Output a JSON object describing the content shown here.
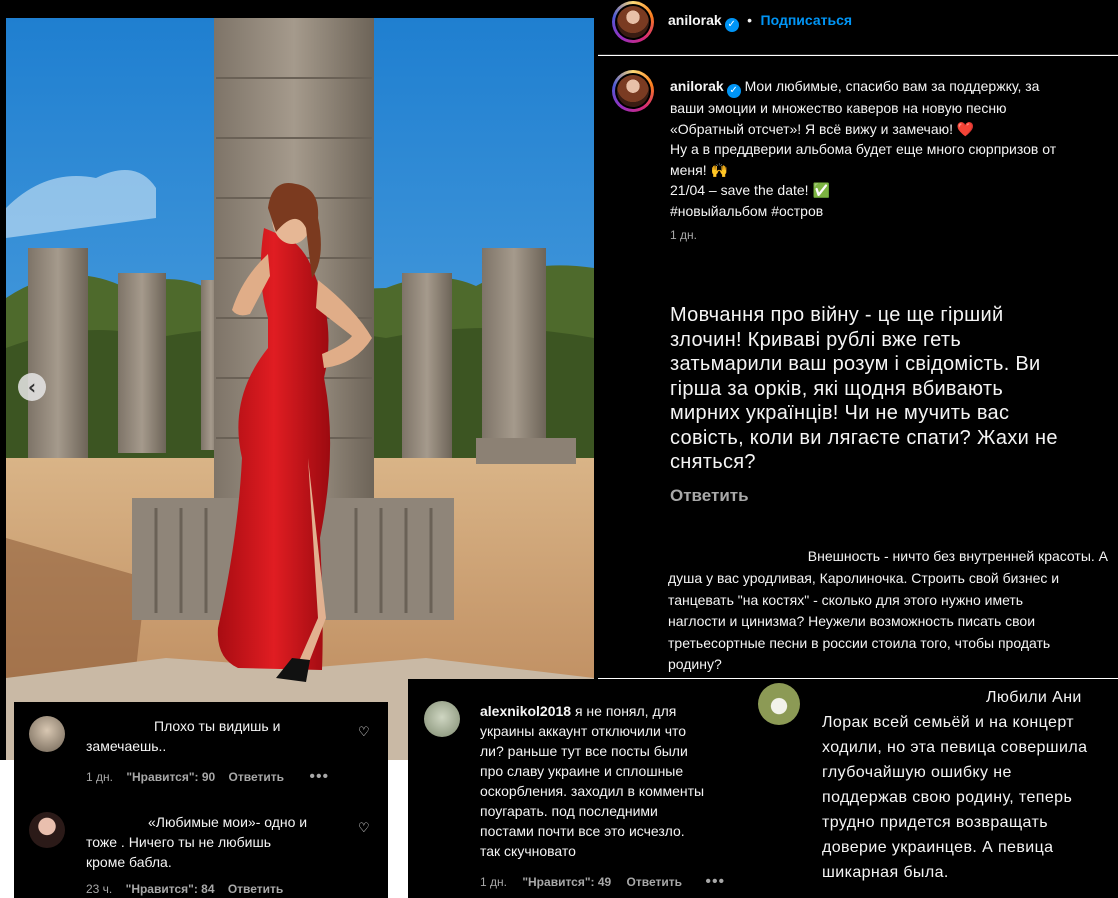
{
  "post": {
    "username": "anilorak",
    "follow_label": "Подписаться",
    "bullet": "•",
    "verified_glyph": "✓",
    "caption_lines": [
      "Мои любимые, спасибо вам за поддержку, за",
      "ваши эмоции и множество каверов на новую песню",
      "«Обратный отсчет»! Я всё вижу и замечаю! ❤️",
      "Ну а в преддверии альбома будет еще много сюрпризов от",
      "меня! 🙌",
      "21/04 – save the date! ✅",
      "#новыйальбом #остров"
    ],
    "time": "1 дн.",
    "carousel_prev": "‹"
  },
  "comment_big": {
    "lines": [
      "Мовчання про війну - це ще гірший",
      "злочин! Криваві рублі вже геть",
      "затьмарили ваш розум і свідомість. Ви",
      "гірша за орків, які щодня вбивають",
      "мирних українців! Чи не мучить вас",
      "совість, коли ви лягаєте спати? Жахи не",
      "сняться?"
    ],
    "reply_label": "Ответить"
  },
  "comment_beauty": {
    "lines": [
      "Внешность - ничто без внутренней красоты. А",
      "душа у вас уродливая, Каролиночка. Строить свой бизнес и",
      "танцевать \"на костях\" - сколько для этого нужно иметь",
      "наглости и цинизма? Неужели возможность писать свои",
      "третьесортные песни в россии стоила того, чтобы продать",
      "родину?"
    ]
  },
  "comment_left_1": {
    "lines": [
      "Плохо ты видишь и",
      "замечаешь.."
    ],
    "time": "1 дн.",
    "likes": "\"Нравится\": 90",
    "reply_label": "Ответить",
    "more": "•••"
  },
  "comment_left_2": {
    "lines": [
      "«Любимые мои»- одно и",
      "тоже . Ничего ты не любишь",
      "кроме бабла."
    ],
    "time": "23 ч.",
    "likes": "\"Нравится\": 84",
    "reply_label": "Ответить"
  },
  "comment_mid": {
    "username": "alexnikol2018",
    "lines": [
      "я не понял, для",
      "украины аккаунт отключили что",
      "ли? раньше тут все посты были",
      "про славу украине и сплошные",
      "оскорбления. заходил в комменты",
      "поугарать. под последними",
      "постами почти все это исчезло.",
      "так скучновато"
    ],
    "time": "1 дн.",
    "likes": "\"Нравится\": 49",
    "reply_label": "Ответить",
    "more": "•••"
  },
  "comment_right": {
    "lines": [
      "Любили Ани",
      "Лорак всей семьёй и на концерт",
      "ходили, но эта певица совершила",
      "глубочайшую ошибку не",
      "поддержав свою родину, теперь",
      "трудно придется возвращать",
      "доверие украинцев. А певица",
      "шикарная была."
    ]
  },
  "icons": {
    "heart": "♡"
  },
  "colors": {
    "background": "#000000",
    "link": "#0095f6",
    "muted": "#a8a8a8",
    "dress": "#d4151b",
    "sky": "#2f8ed8"
  }
}
